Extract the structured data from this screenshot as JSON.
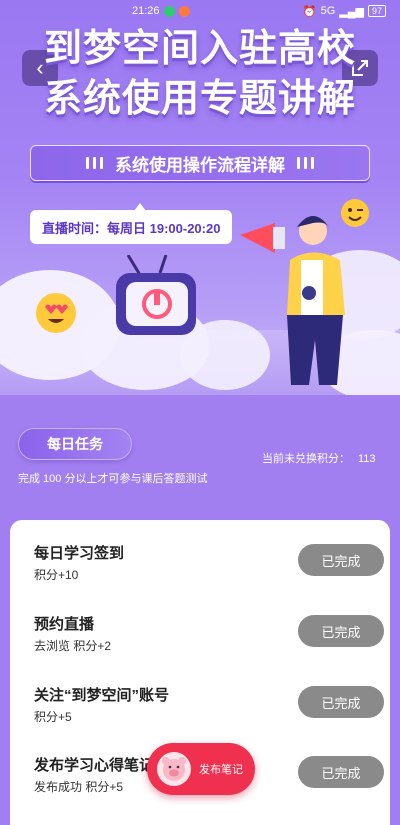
{
  "status_bar": {
    "time": "21:26",
    "network": "5G",
    "battery": "97"
  },
  "hero": {
    "title_line1": "到梦空间入驻高校",
    "title_line2": "系统使用专题讲解",
    "subtitle": "系统使用操作流程详解",
    "live_time": "直播时间：每周日 19:00-20:20"
  },
  "tasks_header": {
    "label": "每日任务",
    "points_label": "当前未兑换积分：",
    "points_value": "113",
    "hint": "完成 100 分以上才可参与课后答题测试"
  },
  "tasks": [
    {
      "title": "每日学习签到",
      "desc": "积分+10",
      "status": "已完成"
    },
    {
      "title": "预约直播",
      "desc": "去浏览 积分+2",
      "status": "已完成"
    },
    {
      "title": "关注“到梦空间”账号",
      "desc": "积分+5",
      "status": "已完成"
    },
    {
      "title": "发布学习心得笔记",
      "desc": "发布成功 积分+5",
      "status": "已完成"
    }
  ],
  "fab": {
    "label": "发布笔记"
  },
  "icons": {
    "back": "chevron-left-icon",
    "share": "share-icon"
  },
  "colors": {
    "accent": "#9a78f2",
    "fab": "#f0304f",
    "done_button": "#8a8a8a"
  }
}
